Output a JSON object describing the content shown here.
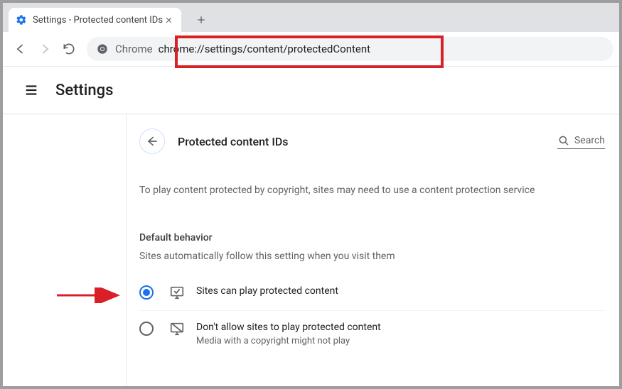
{
  "tab": {
    "title": "Settings - Protected content IDs"
  },
  "omnibox": {
    "prefix": "Chrome",
    "url": "chrome://settings/content/protectedContent"
  },
  "settings_header": {
    "title": "Settings"
  },
  "page": {
    "title": "Protected content IDs",
    "search_placeholder": "Search",
    "description": "To play content protected by copyright, sites may need to use a content protection service",
    "section_title": "Default behavior",
    "section_subtitle": "Sites automatically follow this setting when you visit them",
    "options": [
      {
        "primary": "Sites can play protected content",
        "secondary": "",
        "checked": true
      },
      {
        "primary": "Don't allow sites to play protected content",
        "secondary": "Media with a copyright might not play",
        "checked": false
      }
    ]
  },
  "annotations": {
    "red_box_target": "omnibox-url",
    "arrow_target": "option-allow"
  }
}
